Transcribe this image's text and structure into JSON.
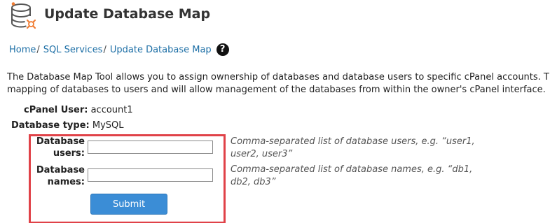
{
  "header": {
    "title": "Update Database Map",
    "icon": "database-icon",
    "icon_colors": {
      "outline": "#555555",
      "accent": "#f07c32"
    }
  },
  "breadcrumb": {
    "items": [
      "Home",
      "SQL Services",
      "Update Database Map"
    ],
    "separator": "/",
    "help_icon": "help-icon",
    "link_color": "#1d6fa6"
  },
  "description": {
    "line1": "The Database Map Tool allows you to assign ownership of databases and database users to specific cPanel accounts. This",
    "line2": "mapping of databases to users and will allow management of the databases from within the owner's cPanel interface."
  },
  "info": {
    "cpanel_user_label": "cPanel User:",
    "cpanel_user_value": "account1",
    "db_type_label": "Database type:",
    "db_type_value": "MySQL"
  },
  "form": {
    "users_label_line1": "Database",
    "users_label_line2": "users:",
    "users_value": "",
    "users_hint": "Comma-separated list of database users, e.g. “user1, user2, user3”",
    "names_label_line1": "Database",
    "names_label_line2": "names:",
    "names_value": "",
    "names_hint": "Comma-separated list of database names, e.g. “db1, db2, db3”",
    "submit_label": "Submit",
    "submit_color": "#3b8dd6",
    "highlight_color": "#e04248"
  }
}
